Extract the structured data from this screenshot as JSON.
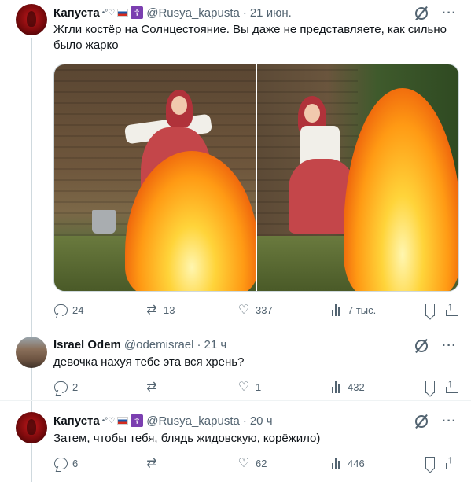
{
  "tweets": [
    {
      "name": "Капуста",
      "badge_symbols": "•°♡",
      "handle": "@Rusya_kapusta",
      "separator": "·",
      "time": "21 июн.",
      "text": "Жгли костёр на Солнцестояние. Вы даже не представляете, как сильно было жарко",
      "reply_count": "24",
      "retweet_count": "13",
      "like_count": "337",
      "view_count": "7 тыс."
    },
    {
      "name": "Israel Odem",
      "handle": "@odemisrael",
      "separator": "·",
      "time": "21 ч",
      "text": "девочка нахуя тебе эта вся хрень?",
      "reply_count": "2",
      "retweet_count": "",
      "like_count": "1",
      "view_count": "432"
    },
    {
      "name": "Капуста",
      "badge_symbols": "•°♡",
      "handle": "@Rusya_kapusta",
      "separator": "·",
      "time": "20 ч",
      "text": "Затем, чтобы тебя, блядь жидовскую, корёжило)",
      "reply_count": "6",
      "retweet_count": "",
      "like_count": "62",
      "view_count": "446"
    }
  ],
  "icons": {
    "more": "···",
    "cross": "☦"
  },
  "colors": {
    "muted": "#536471",
    "divider": "#eff3f4",
    "thread_line": "#cfd9de"
  }
}
